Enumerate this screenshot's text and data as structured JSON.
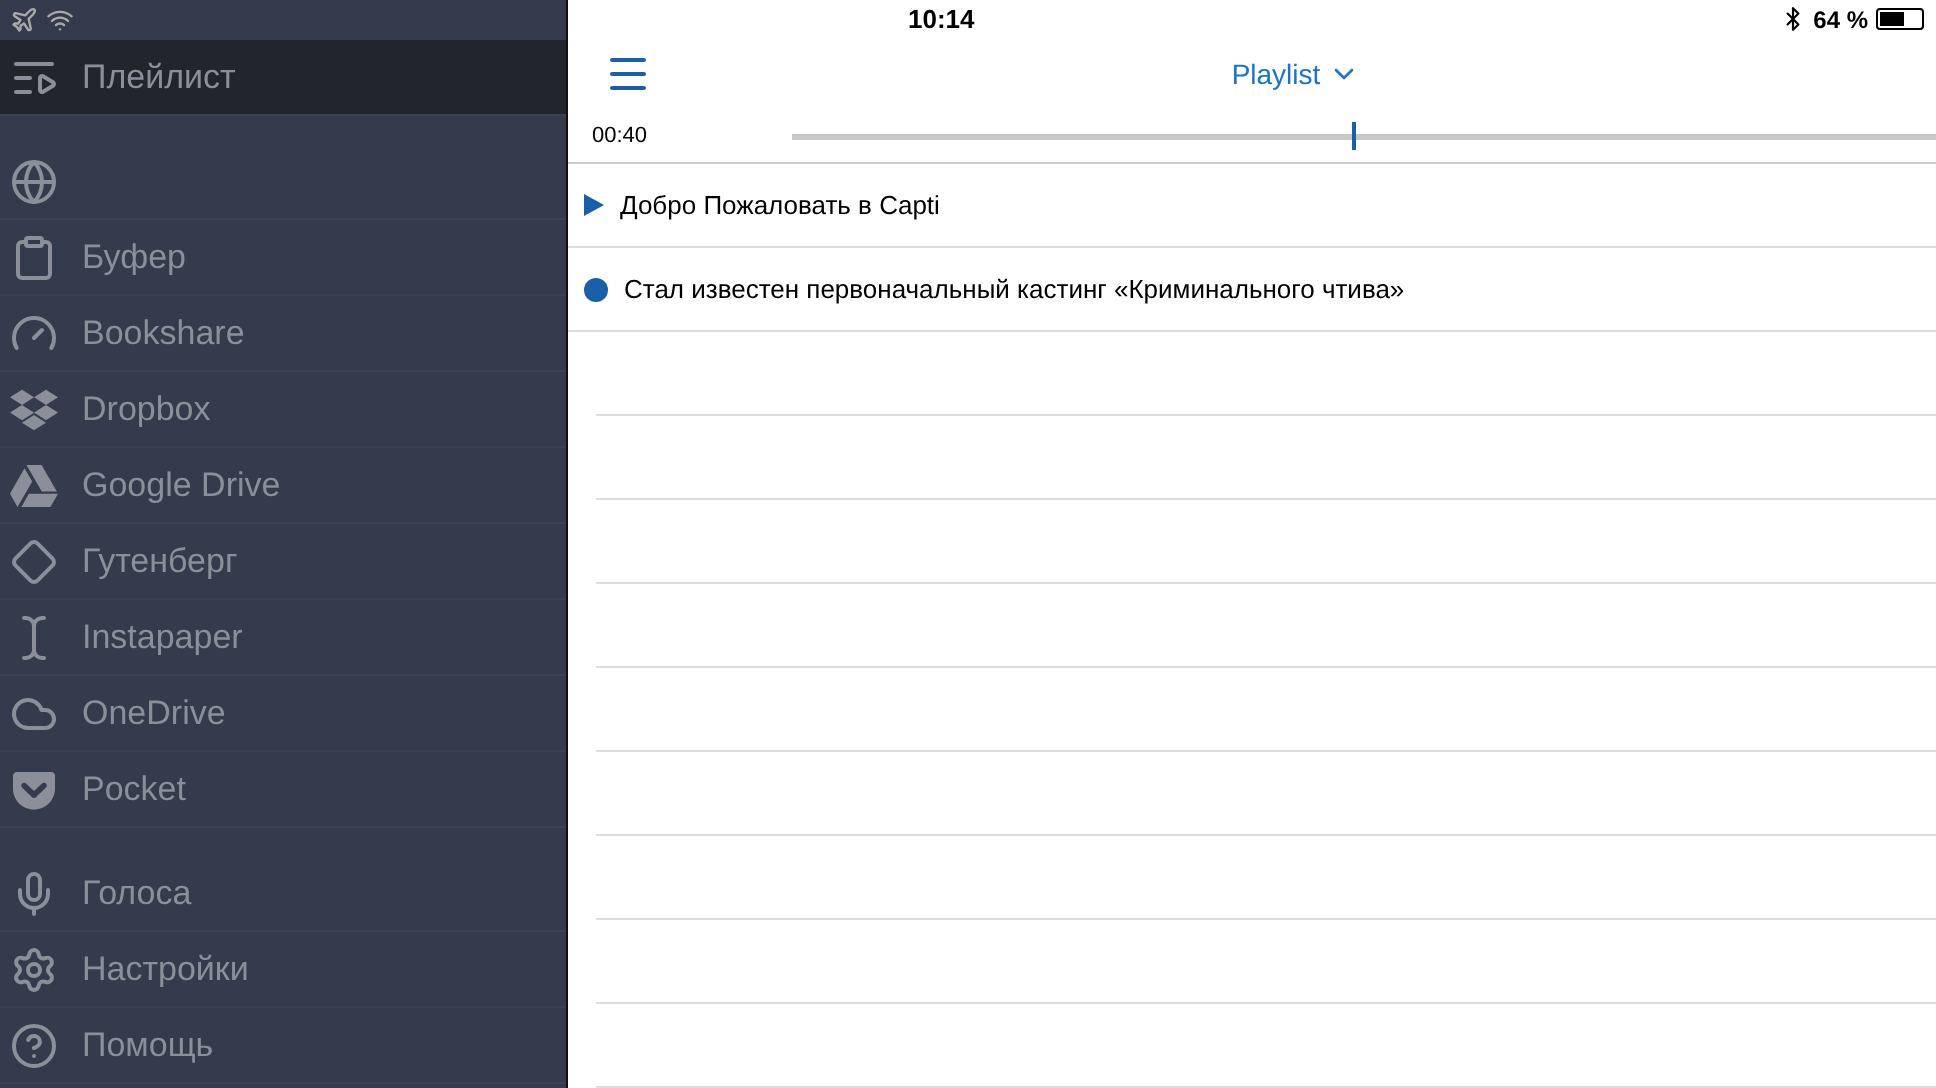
{
  "status_bar": {
    "time": "10:14",
    "battery": "64 %"
  },
  "sidebar": {
    "items": [
      {
        "label": "Плейлист",
        "selected": true
      },
      {
        "selected": false
      },
      {
        "label": "Буфер",
        "selected": false
      },
      {
        "label": "Bookshare",
        "selected": false
      },
      {
        "label": "Dropbox",
        "selected": false
      },
      {
        "label": "Google Drive",
        "selected": false
      },
      {
        "label": "Гутенберг",
        "selected": false
      },
      {
        "label": "Instapaper",
        "selected": false
      },
      {
        "label": "OneDrive",
        "selected": false
      },
      {
        "label": "Pocket",
        "selected": false
      }
    ],
    "menu": [
      {
        "label": "Голоса"
      },
      {
        "label": "Настройки"
      },
      {
        "label": "Помощь"
      }
    ]
  },
  "header": {
    "title": "Playlist"
  },
  "player": {
    "elapsed": "00:40",
    "level": 0.49
  },
  "playlist": [
    {
      "title": "Добро Пожаловать в Capti",
      "kind": "playing"
    },
    {
      "title": "Стал известен первоначальный кастинг «Криминального чтива»",
      "kind": "unread"
    }
  ]
}
